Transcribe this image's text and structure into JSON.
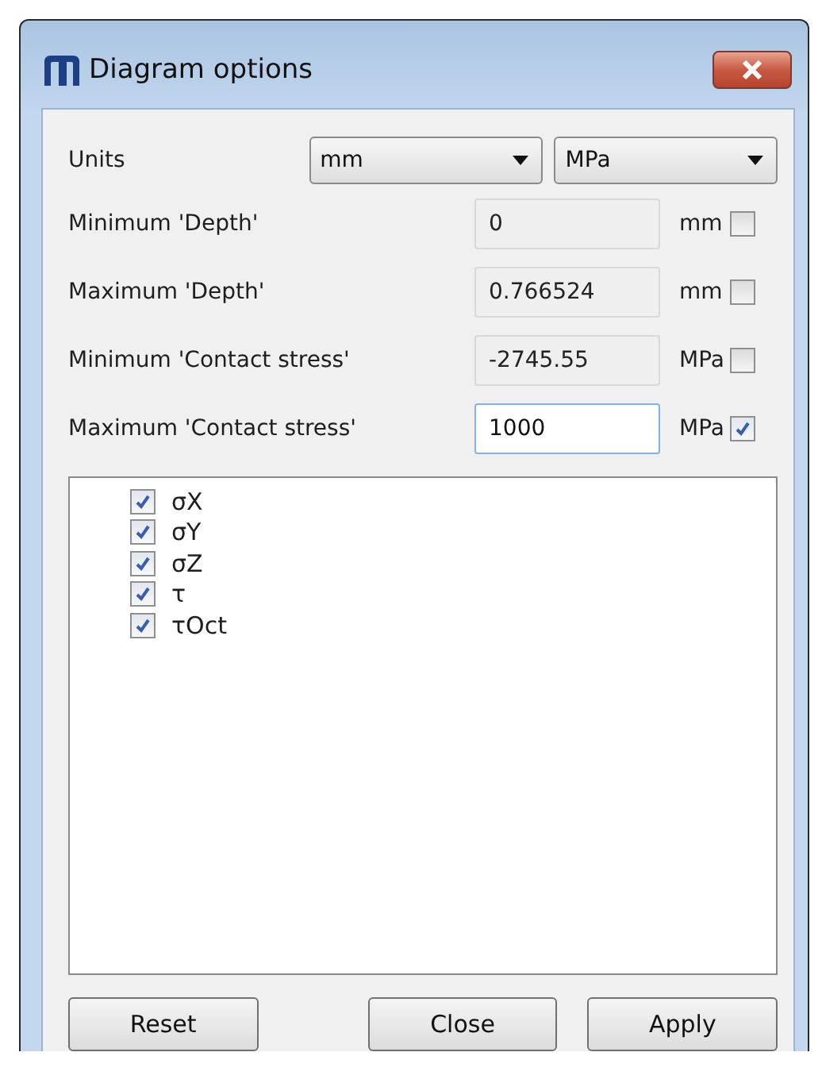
{
  "window": {
    "title": "Diagram options"
  },
  "units": {
    "label": "Units",
    "length": "mm",
    "stress": "MPa"
  },
  "limits": [
    {
      "label": "Minimum 'Depth'",
      "value": "0",
      "unit": "mm",
      "disabled": true,
      "checked": false
    },
    {
      "label": "Maximum 'Depth'",
      "value": "0.766524",
      "unit": "mm",
      "disabled": true,
      "checked": false
    },
    {
      "label": "Minimum 'Contact stress'",
      "value": "-2745.55",
      "unit": "MPa",
      "disabled": true,
      "checked": false
    },
    {
      "label": "Maximum 'Contact stress'",
      "value": "1000",
      "unit": "MPa",
      "disabled": false,
      "checked": true
    }
  ],
  "components": [
    {
      "label": "σX",
      "checked": true
    },
    {
      "label": "σY",
      "checked": true
    },
    {
      "label": "σZ",
      "checked": true
    },
    {
      "label": "τ",
      "checked": true
    },
    {
      "label": "τOct",
      "checked": true
    }
  ],
  "buttons": [
    "Reset",
    "Close",
    "Apply"
  ]
}
